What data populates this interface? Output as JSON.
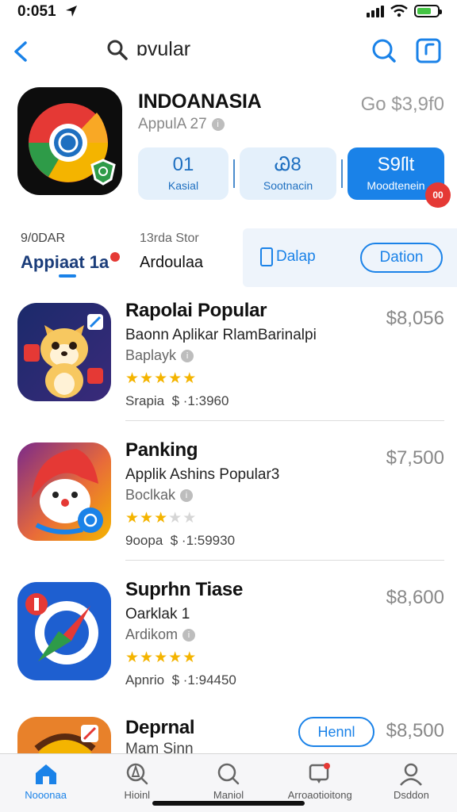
{
  "status_bar": {
    "time": "0:051"
  },
  "nav": {
    "search_text": "ɒvular"
  },
  "featured": {
    "title": "INDOANASIA",
    "subtitle": "AppulA 27",
    "price": "Go $3,9f0",
    "actions": [
      {
        "top": "01",
        "bottom": "Kasial"
      },
      {
        "top": "Ꮚ8",
        "bottom": "Sootnacin"
      },
      {
        "top": "S9ſlt",
        "bottom": "Moodtenein",
        "badge": "00"
      }
    ]
  },
  "segments": {
    "left": {
      "top": "9/0DAR",
      "bottom": "Appiaat 1a"
    },
    "middle": {
      "top": "13rda Stor",
      "bottom": "Ardoulaa"
    },
    "dalap": "Dalap",
    "dation": "Dation"
  },
  "apps": [
    {
      "title": "Rapolai Popular",
      "subtitle": "Baonn Aplikar RlamBarinalpi",
      "developer": "Baplayk",
      "rating": 5,
      "meta_label": "Srapia",
      "meta_value": "$ ·1:3960",
      "price": "$8,056"
    },
    {
      "title": "Panking",
      "subtitle": "Applik Ashins Popular3",
      "developer": "Boclkak",
      "rating": 3.5,
      "meta_label": "9oopa",
      "meta_value": "$ ·1:59930",
      "price": "$7,500"
    },
    {
      "title": "Suprhn Tiase",
      "subtitle": "Oarklak 1",
      "developer": "Ardikom",
      "rating": 5,
      "meta_label": "Apnrio",
      "meta_value": "$ ·1:94450",
      "price": "$8,600"
    }
  ],
  "partial_app": {
    "title": "Deprnal",
    "subtitle": "Mam Sinn",
    "button": "Hennl",
    "price": "$8,500"
  },
  "tabs": [
    {
      "label": "Nooonaa",
      "icon": "home-icon",
      "active": true
    },
    {
      "label": "Hioinl",
      "icon": "compass-icon",
      "active": false
    },
    {
      "label": "Maniol",
      "icon": "search-icon",
      "active": false
    },
    {
      "label": "Arroaotioitong",
      "icon": "notification-icon",
      "active": false
    },
    {
      "label": "Dsddon",
      "icon": "person-icon",
      "active": false
    }
  ],
  "colors": {
    "accent": "#1a82e8",
    "star": "#f4b400",
    "badge": "#e53935"
  }
}
